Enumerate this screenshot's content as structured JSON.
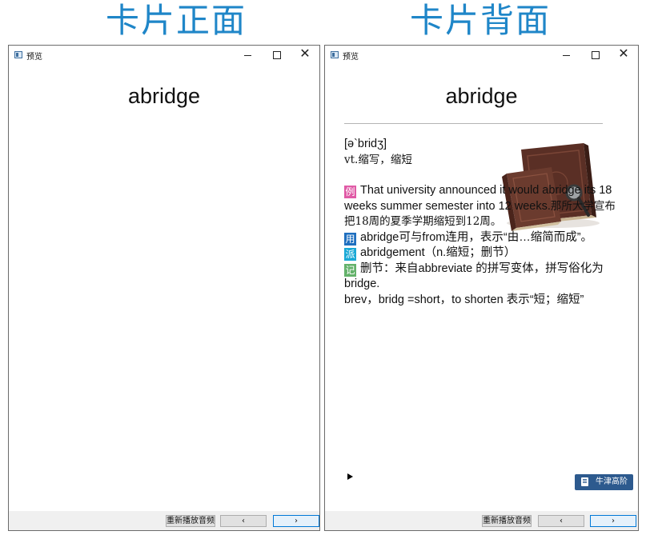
{
  "headings": {
    "front": "卡片正面",
    "back": "卡片背面"
  },
  "front_window": {
    "title": "预览",
    "controls": {
      "close": "✕"
    },
    "word": "abridge",
    "status": {
      "replay": "重新播放音频",
      "prev": "‹",
      "next": "›"
    }
  },
  "back_window": {
    "title": "预览",
    "controls": {
      "close": "✕"
    },
    "word": "abridge",
    "phonetic": "[ə`bridʒ]",
    "definition": "vt.缩写，缩短",
    "example": {
      "badge": "例",
      "text_en": "That university announced it would abridge its 18 weeks summer semester into 12 weeks.",
      "text_zh": "那所大学宣布把18周的夏季学期缩短到12周。"
    },
    "usage": {
      "badge": "用",
      "text": "abridge可与from连用，表示“由…缩简而成”。"
    },
    "derivation": {
      "badge": "派",
      "text": "abridgement（n.缩短；删节）"
    },
    "memory": {
      "badge": "记",
      "text": "删节：来自abbreviate 的拼写变体，拼写俗化为bridge.",
      "text2": "brev，bridg =short，to shorten 表示“短；缩短”"
    },
    "dictionary_button": "牛津高阶",
    "status": {
      "replay": "重新播放音频",
      "prev": "‹",
      "next": "›"
    }
  },
  "colors": {
    "heading": "#1f86c8",
    "badge_example": "#e05aa6",
    "badge_usage": "#1f6fbf",
    "badge_derivation": "#1aa9d6",
    "badge_memory": "#64b26b",
    "dictionary_button": "#2d5a8e"
  }
}
